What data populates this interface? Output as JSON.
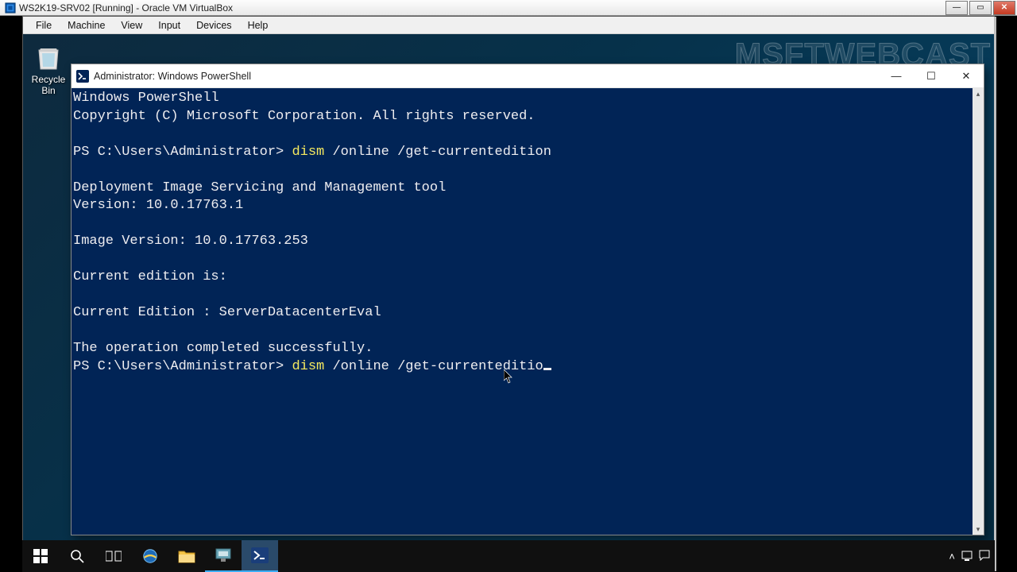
{
  "host_window": {
    "title": "WS2K19-SRV02 [Running] - Oracle VM VirtualBox",
    "min_title": "Minimize",
    "max_title": "Maximize",
    "close_title": "Close"
  },
  "vbox_menu": {
    "file": "File",
    "machine": "Machine",
    "view": "View",
    "input": "Input",
    "devices": "Devices",
    "help": "Help"
  },
  "watermark": "MSFTWEBCAST",
  "desktop": {
    "recycle_bin_label": "Recycle Bin"
  },
  "ps_window": {
    "title": "Administrator: Windows PowerShell",
    "lines": {
      "l1": "Windows PowerShell",
      "l2": "Copyright (C) Microsoft Corporation. All rights reserved.",
      "blank": "",
      "p1_prompt": "PS C:\\Users\\Administrator> ",
      "p1_cmd": "dism",
      "p1_args": " /online /get-currentedition",
      "o1": "Deployment Image Servicing and Management tool",
      "o2": "Version: 10.0.17763.1",
      "o3": "Image Version: 10.0.17763.253",
      "o4": "Current edition is:",
      "o5": "Current Edition : ServerDatacenterEval",
      "o6": "The operation completed successfully.",
      "p2_prompt": "PS C:\\Users\\Administrator> ",
      "p2_cmd": "dism",
      "p2_args": " /online /get-currenteditio"
    },
    "min_title": "Minimize",
    "max_title": "Maximize",
    "close_title": "Close"
  }
}
